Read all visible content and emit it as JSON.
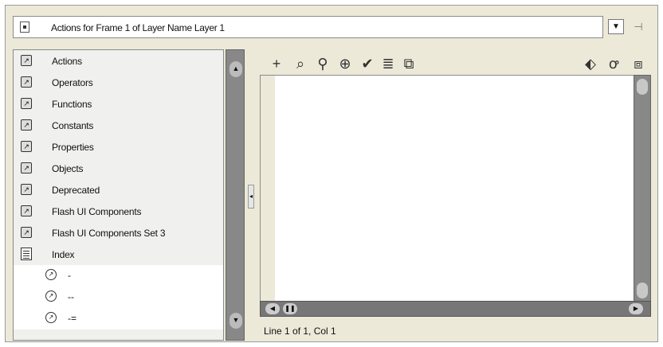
{
  "title": {
    "text": "Actions for Frame 1 of Layer Name Layer 1"
  },
  "categories": [
    {
      "label": "Actions"
    },
    {
      "label": "Operators"
    },
    {
      "label": "Functions"
    },
    {
      "label": "Constants"
    },
    {
      "label": "Properties"
    },
    {
      "label": "Objects"
    },
    {
      "label": "Deprecated"
    },
    {
      "label": "Flash UI Components"
    },
    {
      "label": "Flash UI Components Set 3"
    },
    {
      "label": "Index"
    }
  ],
  "index_entries": [
    "-",
    "--",
    "-="
  ],
  "toolbar": [
    "+",
    "⌕",
    "⚲",
    "⊕",
    "✔",
    "≣",
    "⧉",
    "⬖",
    "ꝍ",
    "⧈"
  ],
  "status": {
    "text": "Line 1 of 1, Col 1"
  }
}
